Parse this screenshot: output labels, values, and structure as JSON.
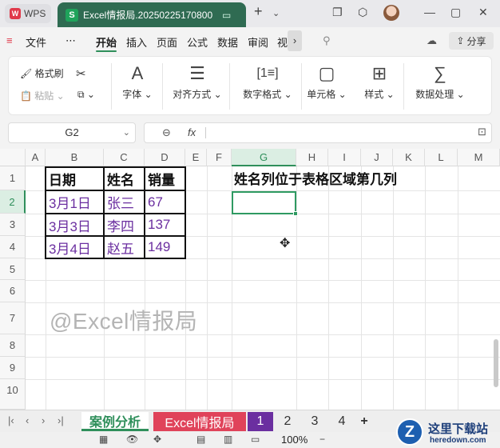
{
  "titlebar": {
    "app_tab": "WPS",
    "doc_tab": "Excel情报局.20250225170800",
    "new_tab_icon": "plus-icon",
    "chevron_icon": "chevron-down-icon"
  },
  "menu": {
    "file": "文件",
    "more": "⋯",
    "tabs": [
      "开始",
      "插入",
      "页面",
      "公式",
      "数据",
      "审阅",
      "视"
    ],
    "share": "分享"
  },
  "toolbar": {
    "format_painter": "格式刷",
    "paste": "粘贴",
    "font": "字体",
    "align": "对齐方式",
    "number_format": "数字格式",
    "cell": "单元格",
    "style": "样式",
    "data_process": "数据处理"
  },
  "formula_bar": {
    "name_box": "G2",
    "fx": "fx",
    "value": ""
  },
  "grid": {
    "columns": [
      "A",
      "B",
      "C",
      "D",
      "E",
      "F",
      "G",
      "H",
      "I",
      "J",
      "K",
      "L",
      "M"
    ],
    "rows": [
      "1",
      "2",
      "3",
      "4",
      "5",
      "6",
      "7",
      "8",
      "9",
      "10"
    ],
    "table": {
      "headers": [
        "日期",
        "姓名",
        "销量"
      ],
      "rows": [
        [
          "3月1日",
          "张三",
          "67"
        ],
        [
          "3月3日",
          "李四",
          "137"
        ],
        [
          "3月4日",
          "赵五",
          "149"
        ]
      ]
    },
    "question": "姓名列位于表格区域第几列",
    "watermark": "@Excel情报局"
  },
  "sheets": {
    "tabs": [
      "案例分析",
      "Excel情报局",
      "1",
      "2",
      "3",
      "4"
    ],
    "add": "+"
  },
  "status": {
    "zoom": "100%",
    "zoom_minus": "−"
  },
  "brand": {
    "name": "这里下载站",
    "url": "heredown.com"
  }
}
